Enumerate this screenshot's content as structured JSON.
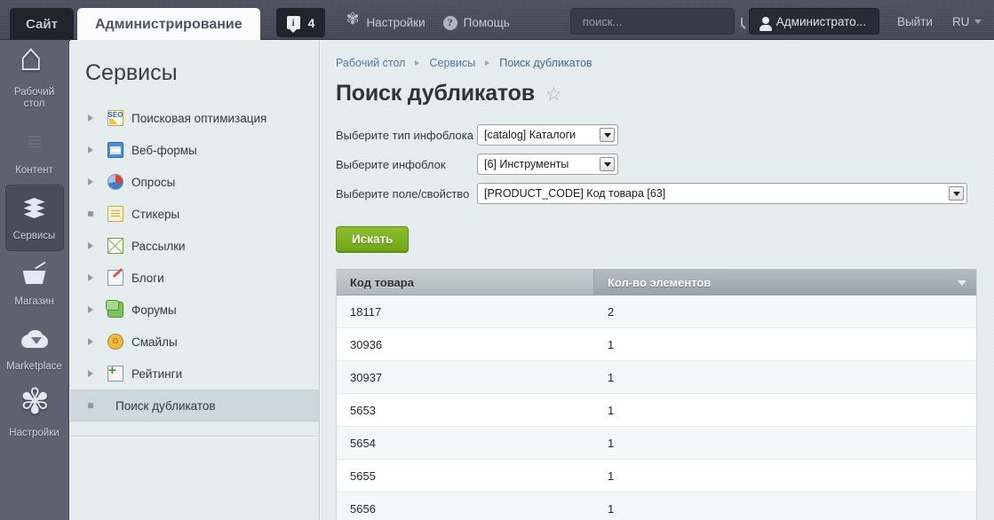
{
  "topbar": {
    "tabs": [
      {
        "label": "Сайт",
        "name": "tab-site"
      },
      {
        "label": "Администрирование",
        "name": "tab-admin"
      }
    ],
    "notifications_count": "4",
    "info_letter": "i",
    "settings_label": "Настройки",
    "help_label": "Помощь",
    "help_glyph": "?",
    "search_placeholder": "поиск...",
    "search_value": "",
    "user_label": "Администрато...",
    "logout_label": "Выйти",
    "lang_label": "RU",
    "icons": {
      "gear": "gear-icon",
      "question": "question-icon",
      "search": "search-icon",
      "person": "person-icon",
      "keyboard": "keyboard-icon",
      "pin": "pin-icon"
    }
  },
  "rail": {
    "items": [
      {
        "label": "Рабочий\nстол",
        "line1": "Рабочий",
        "line2": "стол",
        "icon": "home-icon",
        "name": "rail-item-desktop",
        "active": false
      },
      {
        "label": "Контент",
        "line1": "Контент",
        "line2": "",
        "icon": "document-icon",
        "name": "rail-item-content",
        "active": false
      },
      {
        "label": "Сервисы",
        "line1": "Сервисы",
        "line2": "",
        "icon": "layers-icon",
        "name": "rail-item-services",
        "active": true
      },
      {
        "label": "Магазин",
        "line1": "Магазин",
        "line2": "",
        "icon": "cart-icon",
        "name": "rail-item-shop",
        "active": false
      },
      {
        "label": "Marketplace",
        "line1": "Marketplace",
        "line2": "",
        "icon": "cloud-download-icon",
        "name": "rail-item-marketplace",
        "active": false
      },
      {
        "label": "Настройки",
        "line1": "Настройки",
        "line2": "",
        "icon": "gear-icon",
        "name": "rail-item-settings",
        "active": false
      }
    ]
  },
  "tree": {
    "title": "Сервисы",
    "items": [
      {
        "label": "Поисковая оптимизация",
        "icon": "seo-icon",
        "expander": "arrow",
        "selected": false
      },
      {
        "label": "Веб-формы",
        "icon": "webform-icon",
        "expander": "arrow",
        "selected": false
      },
      {
        "label": "Опросы",
        "icon": "poll-pie-icon",
        "expander": "arrow",
        "selected": false
      },
      {
        "label": "Стикеры",
        "icon": "sticker-icon",
        "expander": "dot",
        "selected": false
      },
      {
        "label": "Рассылки",
        "icon": "mail-icon",
        "expander": "arrow",
        "selected": false
      },
      {
        "label": "Блоги",
        "icon": "blog-pencil-icon",
        "expander": "arrow",
        "selected": false
      },
      {
        "label": "Форумы",
        "icon": "forum-bubbles-icon",
        "expander": "arrow",
        "selected": false
      },
      {
        "label": "Смайлы",
        "icon": "smiley-icon",
        "expander": "arrow",
        "selected": false
      },
      {
        "label": "Рейтинги",
        "icon": "rating-plus-icon",
        "expander": "arrow",
        "selected": false
      },
      {
        "label": "Поиск дубликатов",
        "icon": "none",
        "expander": "dot",
        "selected": true
      }
    ]
  },
  "content": {
    "breadcrumb": [
      {
        "label": "Рабочий стол"
      },
      {
        "label": "Сервисы"
      },
      {
        "label": "Поиск дубликатов"
      }
    ],
    "page_title": "Поиск дубликатов",
    "favorite_star": "☆",
    "form": {
      "fields": [
        {
          "label": "Выберите тип инфоблока",
          "value": "[catalog] Каталоги",
          "name": "iblock-type-select",
          "width": "w1"
        },
        {
          "label": "Выберите инфоблок",
          "value": "[6] Инструменты",
          "name": "iblock-select",
          "width": "w2"
        },
        {
          "label": "Выберите поле/свойство",
          "value": "[PRODUCT_CODE] Код товара [63]",
          "name": "field-property-select",
          "width": "w3"
        }
      ],
      "submit_label": "Искать"
    },
    "table": {
      "columns": [
        "Код товара",
        "Кол-во элементов"
      ],
      "sorted_column": 1,
      "sort_direction": "desc",
      "rows": [
        {
          "code": "18117",
          "count": "2"
        },
        {
          "code": "30936",
          "count": "1"
        },
        {
          "code": "30937",
          "count": "1"
        },
        {
          "code": "5653",
          "count": "1"
        },
        {
          "code": "5654",
          "count": "1"
        },
        {
          "code": "5655",
          "count": "1"
        },
        {
          "code": "5656",
          "count": "1"
        }
      ]
    }
  },
  "colors": {
    "topbar": "#454b57",
    "rail": "#5b616e",
    "panel_bg": "#e4ecee",
    "accent_green": "#7fb024",
    "link_blue": "#4a7ca8",
    "table_header": "#adb7bd",
    "table_header_active": "#98a3aa"
  }
}
